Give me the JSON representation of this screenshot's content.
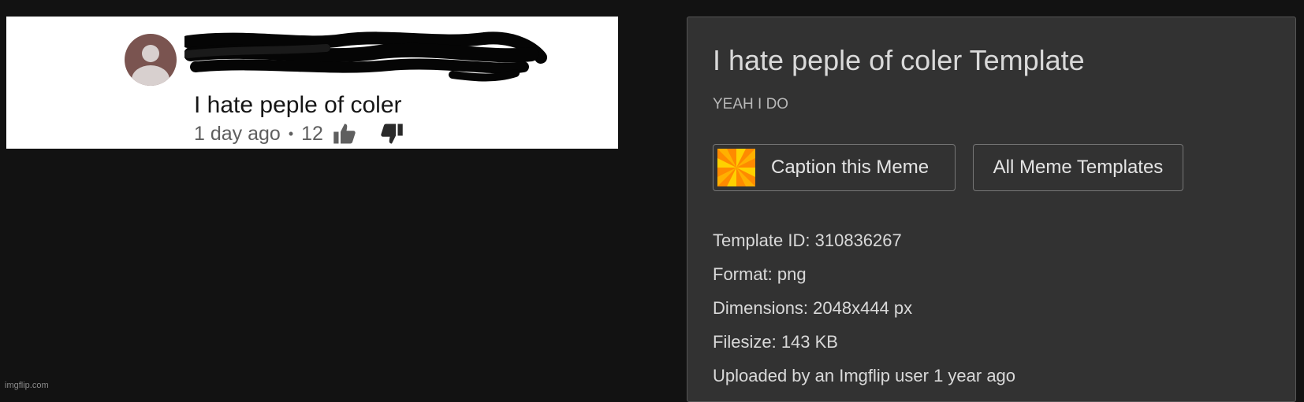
{
  "meme_image": {
    "comment_text": "I hate peple of coler",
    "time_ago": "1 day ago",
    "separator": "•",
    "like_count": "12"
  },
  "watermark": "imgflip.com",
  "panel": {
    "title": "I hate peple of coler Template",
    "subtitle": "YEAH I DO",
    "caption_button_label": "Caption this Meme",
    "all_templates_button_label": "All Meme Templates",
    "info": [
      {
        "label": "Template ID:",
        "value": "310836267"
      },
      {
        "label": "Format:",
        "value": "png"
      },
      {
        "label": "Dimensions:",
        "value": "2048x444 px"
      },
      {
        "label": "Filesize:",
        "value": "143 KB"
      },
      {
        "label": "Uploaded by an Imgflip user",
        "value": "1 year ago"
      }
    ]
  },
  "colors": {
    "background": "#121212",
    "panel": "#323232",
    "pinwheel_orange": "#ff8a00",
    "pinwheel_yellow": "#ffd000"
  },
  "icons": {
    "like": "thumbs-up-icon",
    "dislike": "thumbs-down-icon",
    "caption": "pinwheel-icon",
    "avatar": "avatar-icon"
  }
}
